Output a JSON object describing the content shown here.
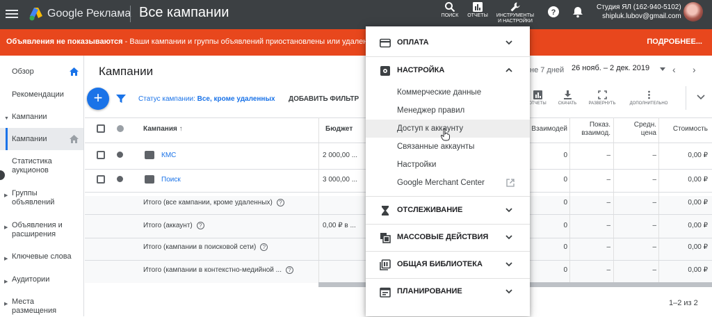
{
  "topbar": {
    "brand": "Google Реклама",
    "page_title": "Все кампании",
    "tools": [
      {
        "label": "ПОИСК",
        "icon": "search-icon"
      },
      {
        "label": "ОТЧЕТЫ",
        "icon": "reports-icon"
      },
      {
        "label1": "ИНСТРУМЕНТЫ",
        "label2": "И НАСТРОЙКИ",
        "icon": "wrench-icon"
      }
    ],
    "account_name": "Студия ЯЛ (162-940-5102)",
    "account_email": "shipluk.lubov@gmail.com"
  },
  "banner": {
    "bold": "Объявления не показываются",
    "text": " - Ваши кампании и группы объявлений приостановлены или удалены. В",
    "more": "ПОДРОБНЕЕ..."
  },
  "sidebar": {
    "items": [
      {
        "label": "Обзор"
      },
      {
        "label": "Рекомендации"
      },
      {
        "label": "Кампании"
      },
      {
        "label": "Кампании"
      },
      {
        "label1": "Статистика",
        "label2": "аукционов"
      },
      {
        "label1": "Группы",
        "label2": "объявлений"
      },
      {
        "label1": "Объявления и",
        "label2": "расширения"
      },
      {
        "label": "Ключевые слова"
      },
      {
        "label": "Аудитории"
      },
      {
        "label1": "Места",
        "label2": "размещения"
      }
    ]
  },
  "main": {
    "title": "Кампании",
    "date_prefix": "не 7 дней",
    "date_range": "26 нояб. – 2 дек. 2019",
    "status_label": "Статус кампании:",
    "status_value": " Все, кроме удаленных",
    "add_filter": "ДОБАВИТЬ ФИЛЬТР",
    "toolbar": [
      "ОТЧЕТЫ",
      "СКАЧАТЬ",
      "РАЗВЕРНУТЬ",
      "ДОПОЛНИТЕЛЬНО"
    ],
    "pager": "1–2 из 2"
  },
  "table": {
    "headers": {
      "campaign": "Кампания",
      "budget": "Бюджет",
      "interactions": "Взаимодей",
      "interaction_rate1": "Показ.",
      "interaction_rate2": "взаимод.",
      "avg_cost1": "Средн.",
      "avg_cost2": "цена",
      "cost": "Стоимость"
    },
    "rows": [
      {
        "name": "КМС",
        "budget": "2 000,00 ...",
        "interactions": "0",
        "rate": "–",
        "avg": "–",
        "cost": "0,00 ₽"
      },
      {
        "name": "Поиск",
        "budget": "3 000,00 ...",
        "interactions": "0",
        "rate": "–",
        "avg": "–",
        "cost": "0,00 ₽"
      }
    ],
    "totals": [
      {
        "label": "Итого (все кампании, кроме удаленных)",
        "budget": "",
        "interactions": "0",
        "rate": "–",
        "avg": "–",
        "cost": "0,00 ₽"
      },
      {
        "label": "Итого (аккаунт)",
        "budget": "0,00 ₽ в ...",
        "interactions": "0",
        "rate": "–",
        "avg": "–",
        "cost": "0,00 ₽"
      },
      {
        "label": "Итого (кампании в поисковой сети)",
        "budget": "",
        "interactions": "0",
        "rate": "–",
        "avg": "–",
        "cost": "0,00 ₽"
      },
      {
        "label": "Итого (кампании в контекстно-медийной ...",
        "budget": "",
        "interactions": "0",
        "rate": "–",
        "avg": "–",
        "cost": "0,00 ₽"
      }
    ]
  },
  "menu": {
    "payment": "ОПЛАТА",
    "setup": "НАСТРОЙКА",
    "setup_items": [
      "Коммерческие данные",
      "Менеджер правил",
      "Доступ к аккаунту",
      "Связанные аккаунты",
      "Настройки",
      "Google Merchant Center"
    ],
    "tracking": "ОТСЛЕЖИВАНИЕ",
    "bulk": "МАССОВЫЕ ДЕЙСТВИЯ",
    "library": "ОБЩАЯ БИБЛИОТЕКА",
    "planning": "ПЛАНИРОВАНИЕ"
  },
  "colors": {
    "topbar": "#3c4043",
    "banner": "#e8471d",
    "accent": "#1a73e8"
  }
}
